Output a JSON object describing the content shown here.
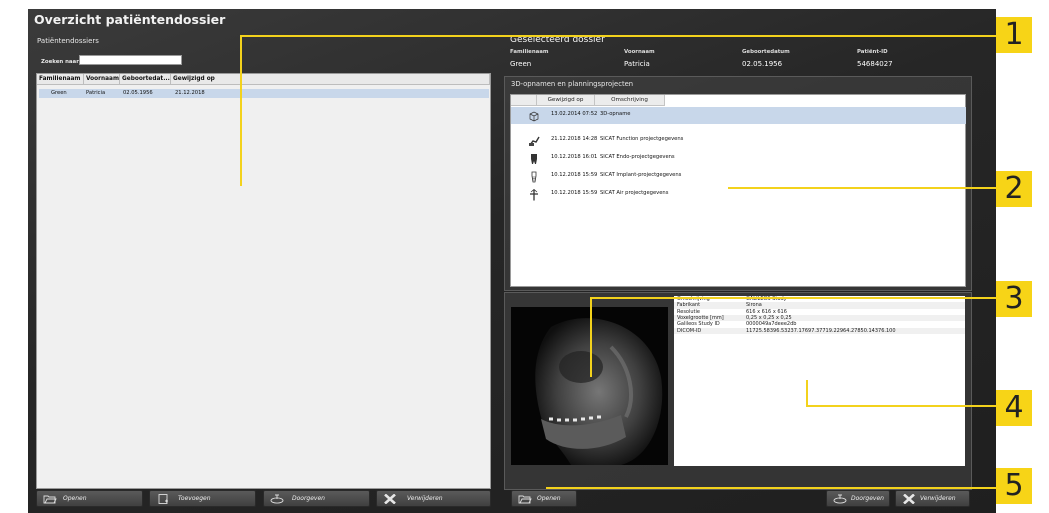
{
  "window": {
    "title": "Overzicht patiëntendossier"
  },
  "left_panel": {
    "title": "Patiëntendossiers",
    "search": {
      "label": "Zoeken naar:",
      "value": ""
    },
    "columns": [
      "Familienaam",
      "Voornaam",
      "Geboortedat...",
      "Gewijzigd op"
    ],
    "rows": [
      {
        "familienaam": "Green",
        "voornaam": "Patricia",
        "geboortedatum": "02.05.1956",
        "gewijzigd": "21.12.2018"
      }
    ],
    "buttons": {
      "open": "Openen",
      "add": "Toevoegen",
      "pass": "Doorgeven",
      "delete": "Verwijderen"
    }
  },
  "selected": {
    "title": "Geselecteerd dossier",
    "labels": {
      "familienaam": "Familienaam",
      "voornaam": "Voornaam",
      "geboortedatum": "Geboortedatum",
      "patient_id": "Patiënt-ID"
    },
    "values": {
      "familienaam": "Green",
      "voornaam": "Patricia",
      "geboortedatum": "02.05.1956",
      "patient_id": "54684027"
    }
  },
  "projects": {
    "title": "3D-opnamen en planningsprojecten",
    "columns": [
      "Gewijzigd op",
      "Omschrijving"
    ],
    "rows": [
      {
        "icon": "volume-cube-icon",
        "date": "13.02.2014 07:52",
        "description": "3D-opname",
        "selected": true
      },
      {
        "icon": "jaw-motion-icon",
        "date": "21.12.2018 14:28",
        "description": "SICAT Function projectgegevens",
        "selected": false
      },
      {
        "icon": "tooth-icon",
        "date": "10.12.2018 16:01",
        "description": "SICAT Endo-projectgegevens",
        "selected": false
      },
      {
        "icon": "implant-icon",
        "date": "10.12.2018 15:59",
        "description": "SICAT Implant-projectgegevens",
        "selected": false
      },
      {
        "icon": "airway-icon",
        "date": "10.12.2018 15:59",
        "description": "SICAT Air projectgegevens",
        "selected": false
      }
    ]
  },
  "details": {
    "properties": [
      {
        "key": "Omschrijving",
        "value": "GALILEOS Study"
      },
      {
        "key": "Fabrikant",
        "value": "Sirona"
      },
      {
        "key": "Resolutie",
        "value": "616 x 616 x 616"
      },
      {
        "key": "Voxelgrootte [mm]",
        "value": "0,25 x 0,25 x 0,25"
      },
      {
        "key": "Galileos Study ID",
        "value": "0000049a7deee2db"
      },
      {
        "key": "DICOM-ID",
        "value": "11725.58396.53237.17697.37719.22964.27850.14376.100"
      }
    ],
    "buttons": {
      "open": "Openen",
      "pass": "Doorgeven",
      "delete": "Verwijderen"
    }
  },
  "callouts": [
    "1",
    "2",
    "3",
    "4",
    "5"
  ],
  "colors": {
    "accent": "#f7d417",
    "selection": "#c8d7ea",
    "background": "#262626"
  }
}
